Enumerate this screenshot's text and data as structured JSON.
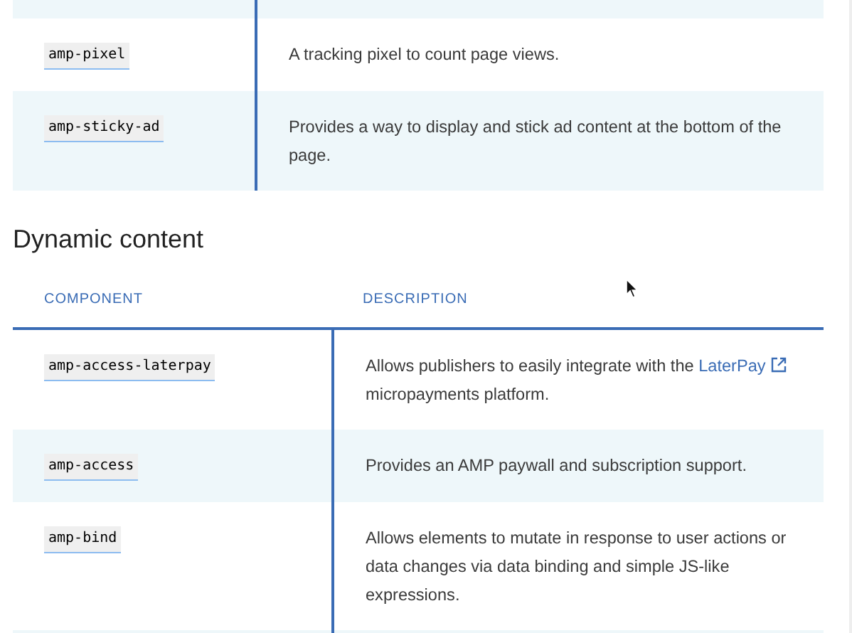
{
  "tables": [
    {
      "rows": [
        {
          "kind": "partial"
        },
        {
          "kind": "entry",
          "component": "amp-pixel",
          "description": "A tracking pixel to count page views."
        },
        {
          "kind": "entry",
          "component": "amp-sticky-ad",
          "description": "Provides a way to display and stick ad content at the bottom of the page."
        }
      ]
    },
    {
      "heading": "Dynamic content",
      "columns": [
        "COMPONENT",
        "DESCRIPTION"
      ],
      "rows": [
        {
          "kind": "entry",
          "component": "amp-access-laterpay",
          "description": "Allows publishers to easily integrate with the",
          "link": "LaterPay",
          "description_after": "micropayments platform."
        },
        {
          "kind": "entry",
          "component": "amp-access",
          "description": "Provides an AMP paywall and subscription support."
        },
        {
          "kind": "entry",
          "component": "amp-bind",
          "description": "Allows elements to mutate in response to user actions or data changes via data binding and simple JS-like expressions."
        },
        {
          "kind": "partial"
        }
      ]
    }
  ]
}
